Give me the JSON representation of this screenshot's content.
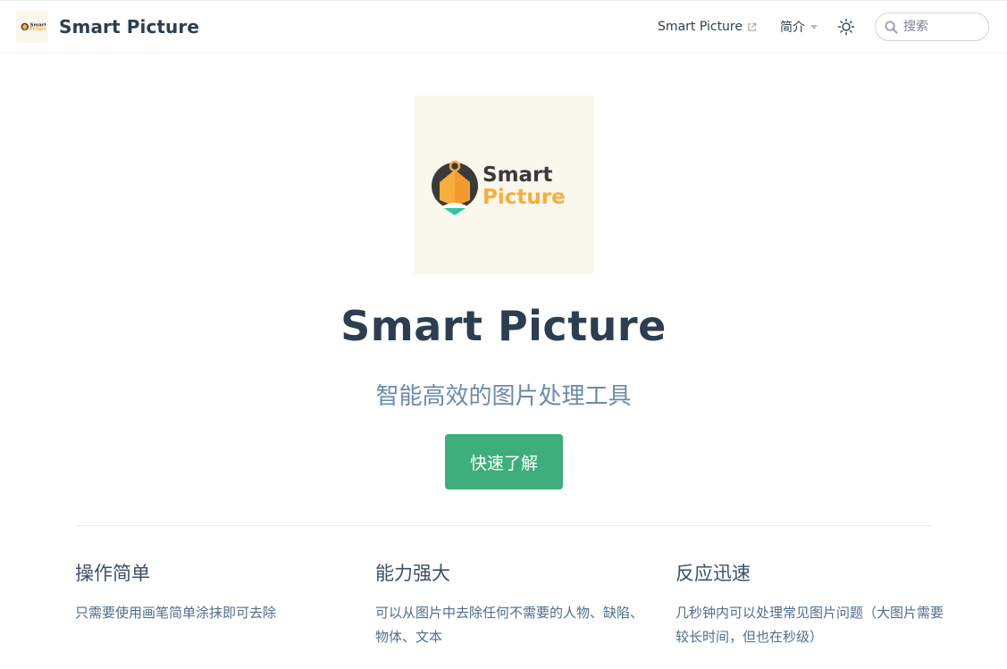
{
  "navbar": {
    "brand_title": "Smart Picture",
    "logo_icon": "smart-picture-logo",
    "links": [
      {
        "label": "Smart Picture",
        "icon": "external-link-icon"
      }
    ],
    "dropdown_label": "简介",
    "theme_icon": "sun-icon",
    "search_placeholder": "搜索"
  },
  "hero": {
    "logo_word1": "Smart",
    "logo_word2": "Picture",
    "title": "Smart Picture",
    "description": "智能高效的图片处理工具",
    "action_label": "快速了解"
  },
  "features": [
    {
      "title": "操作简单",
      "details": "只需要使用画笔简单涂抹即可去除"
    },
    {
      "title": "能力强大",
      "details": "可以从图片中去除任何不需要的人物、缺陷、物体、文本"
    },
    {
      "title": "反应迅速",
      "details": "几秒钟内可以处理常见图片问题（大图片需要较长时间，但也在秒级）"
    }
  ],
  "colors": {
    "accent": "#3eaf7c",
    "logo_orange": "#f8ad3c",
    "logo_dark": "#3a3a3a",
    "logo_teal": "#2ec4a5",
    "logo_bg": "#faf7ec"
  }
}
